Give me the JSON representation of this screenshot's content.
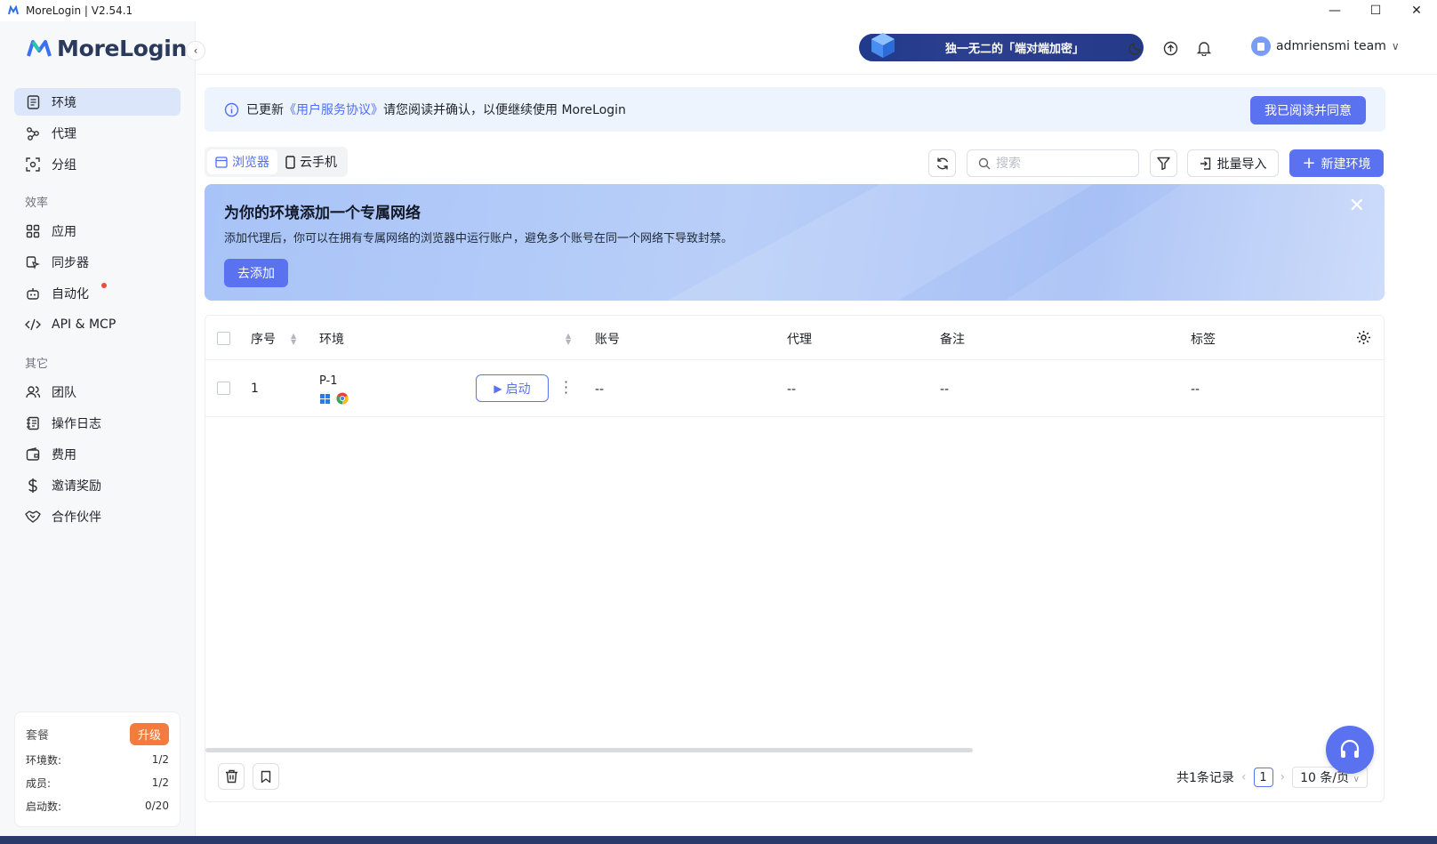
{
  "window": {
    "title": "MoreLogin | V2.54.1",
    "minimize": "—",
    "maximize": "☐",
    "close": "✕"
  },
  "sidebar": {
    "logo": "MoreLogin",
    "items": [
      {
        "label": "环境",
        "icon": "document-icon"
      },
      {
        "label": "代理",
        "icon": "proxy-icon"
      },
      {
        "label": "分组",
        "icon": "group-icon"
      }
    ],
    "section_efficiency": "效率",
    "efficiency_items": [
      {
        "label": "应用",
        "icon": "apps-icon"
      },
      {
        "label": "同步器",
        "icon": "sync-icon"
      },
      {
        "label": "自动化",
        "icon": "robot-icon"
      },
      {
        "label": "API & MCP",
        "icon": "code-icon"
      }
    ],
    "section_other": "其它",
    "other_items": [
      {
        "label": "团队",
        "icon": "team-icon"
      },
      {
        "label": "操作日志",
        "icon": "log-icon"
      },
      {
        "label": "费用",
        "icon": "wallet-icon"
      },
      {
        "label": "邀请奖励",
        "icon": "dollar-icon"
      },
      {
        "label": "合作伙伴",
        "icon": "handshake-icon"
      }
    ],
    "plan": {
      "title": "套餐",
      "upgrade": "升级",
      "rows": [
        {
          "label": "环境数:",
          "value": "1/2"
        },
        {
          "label": "成员:",
          "value": "1/2"
        },
        {
          "label": "启动数:",
          "value": "0/20"
        }
      ]
    }
  },
  "header": {
    "promo": "独一无二的「端对端加密」",
    "user": "admriensmi team"
  },
  "notice": {
    "prefix": "已更新",
    "link": "《用户服务协议》",
    "suffix": "请您阅读并确认，以便继续使用 MoreLogin",
    "button": "我已阅读并同意"
  },
  "tabs": [
    {
      "label": "浏览器",
      "active": true
    },
    {
      "label": "云手机",
      "active": false
    }
  ],
  "toolbar": {
    "search_placeholder": "搜索",
    "import": "批量导入",
    "new": "新建环境"
  },
  "banner": {
    "title": "为你的环境添加一个专属网络",
    "text": "添加代理后，你可以在拥有专属网络的浏览器中运行账户，避免多个账号在同一个网络下导致封禁。",
    "button": "去添加",
    "close": "✕"
  },
  "table": {
    "columns": [
      "序号",
      "环境",
      "账号",
      "代理",
      "备注",
      "标签"
    ],
    "rows": [
      {
        "index": "1",
        "name": "P-1",
        "start": "启动",
        "account": "--",
        "proxy": "--",
        "note": "--",
        "tag": "--"
      }
    ]
  },
  "footer": {
    "total": "共1条记录",
    "page": "1",
    "per_page": "10 条/页"
  },
  "colors": {
    "accent": "#5a72f0",
    "upgrade": "#f47b3e",
    "active_nav": "#dbe6fb"
  }
}
